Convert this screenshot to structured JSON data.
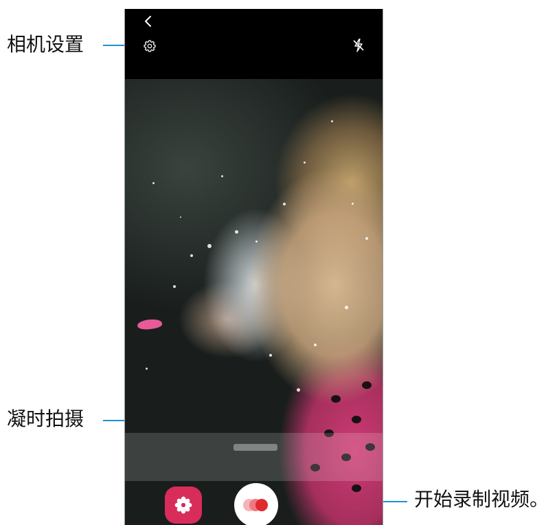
{
  "callouts": {
    "camera_settings": "相机设置",
    "hyperlapse": "凝时拍摄",
    "start_recording": "开始录制视频。"
  },
  "icons": {
    "back": "chevron-left-icon",
    "settings": "gear-icon",
    "flash": "flash-off-icon",
    "gallery": "flower-icon",
    "record": "record-dots-icon"
  },
  "colors": {
    "leader_line": "#1e8fd6",
    "gallery_button": "#d82c5a",
    "record_dot": "#e0282f"
  }
}
